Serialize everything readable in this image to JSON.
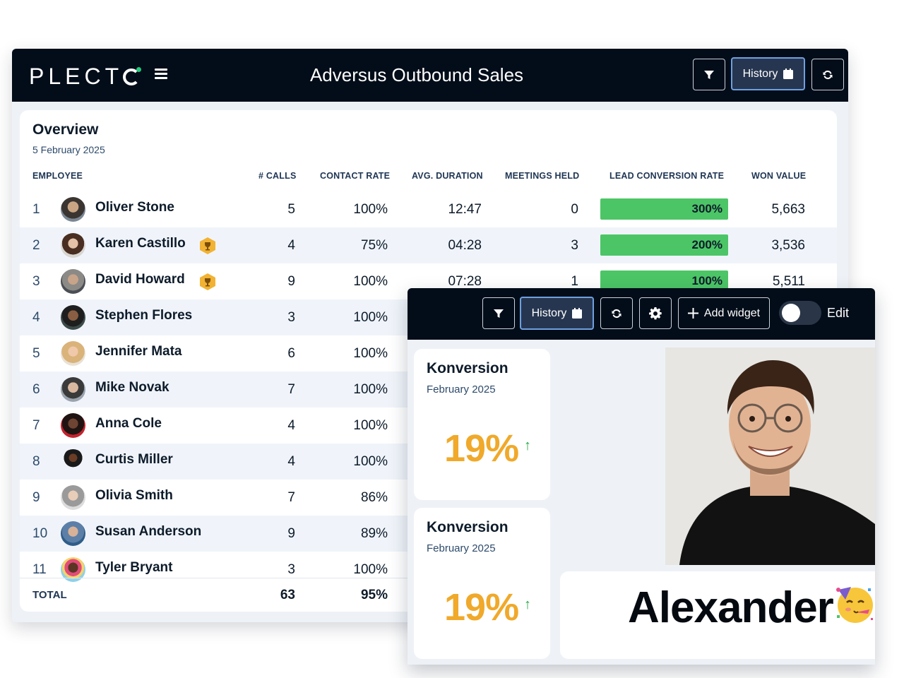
{
  "app": {
    "logo_text": "PLECTO",
    "dashboard_title": "Adversus Outbound Sales",
    "history_label": "History"
  },
  "overview": {
    "title": "Overview",
    "date": "5 February 2025",
    "columns": [
      "EMPLOYEE",
      "# CALLS",
      "CONTACT RATE",
      "AVG. DURATION",
      "MEETINGS HELD",
      "LEAD CONVERSION RATE",
      "WON VALUE"
    ],
    "rows": [
      {
        "rank": "1",
        "name": "Oliver Stone",
        "calls": "5",
        "contact_rate": "100%",
        "avg_duration": "12:47",
        "meetings": "0",
        "lead_conversion": "300%",
        "lead_conversion_fill": 1.0,
        "won_value": "5,663",
        "badge": false
      },
      {
        "rank": "2",
        "name": "Karen Castillo",
        "calls": "4",
        "contact_rate": "75%",
        "avg_duration": "04:28",
        "meetings": "3",
        "lead_conversion": "200%",
        "lead_conversion_fill": 1.0,
        "won_value": "3,536",
        "badge": true
      },
      {
        "rank": "3",
        "name": "David Howard",
        "calls": "9",
        "contact_rate": "100%",
        "avg_duration": "07:28",
        "meetings": "1",
        "lead_conversion": "100%",
        "lead_conversion_fill": 1.0,
        "won_value": "5,511",
        "badge": true
      },
      {
        "rank": "4",
        "name": "Stephen Flores",
        "calls": "3",
        "contact_rate": "100%"
      },
      {
        "rank": "5",
        "name": "Jennifer Mata",
        "calls": "6",
        "contact_rate": "100%"
      },
      {
        "rank": "6",
        "name": "Mike Novak",
        "calls": "7",
        "contact_rate": "100%"
      },
      {
        "rank": "7",
        "name": "Anna Cole",
        "calls": "4",
        "contact_rate": "100%"
      },
      {
        "rank": "8",
        "name": "Curtis Miller",
        "calls": "4",
        "contact_rate": "100%"
      },
      {
        "rank": "9",
        "name": "Olivia Smith",
        "calls": "7",
        "contact_rate": "86%"
      },
      {
        "rank": "10",
        "name": "Susan Anderson",
        "calls": "9",
        "contact_rate": "89%"
      },
      {
        "rank": "11",
        "name": "Tyler Bryant",
        "calls": "3",
        "contact_rate": "100%"
      }
    ],
    "total": {
      "label": "TOTAL",
      "calls": "63",
      "contact_rate": "95%"
    }
  },
  "front": {
    "history_label": "History",
    "add_widget_label": "Add widget",
    "edit_label": "Edit",
    "edit_toggle_on": false,
    "kpis": [
      {
        "title": "Konversion",
        "subtitle": "February 2025",
        "value": "19%",
        "trend": "↑"
      },
      {
        "title": "Konversion",
        "subtitle": "February 2025",
        "value": "19%",
        "trend": "↑"
      }
    ],
    "celebration_name": "Alexander"
  },
  "colors": {
    "topbar": "#030d19",
    "bar_green": "#4cc566",
    "kpi_orange": "#f0a92a",
    "trend_green": "#2aa84a",
    "badge_gold": "#f2b233"
  },
  "icons": {
    "filter": "filter-icon",
    "calendar": "calendar-icon",
    "refresh": "refresh-icon",
    "settings": "gear-icon",
    "add": "plus-icon",
    "menu": "hamburger-icon",
    "badge": "trophy-icon",
    "emoji": "party-face-emoji"
  }
}
